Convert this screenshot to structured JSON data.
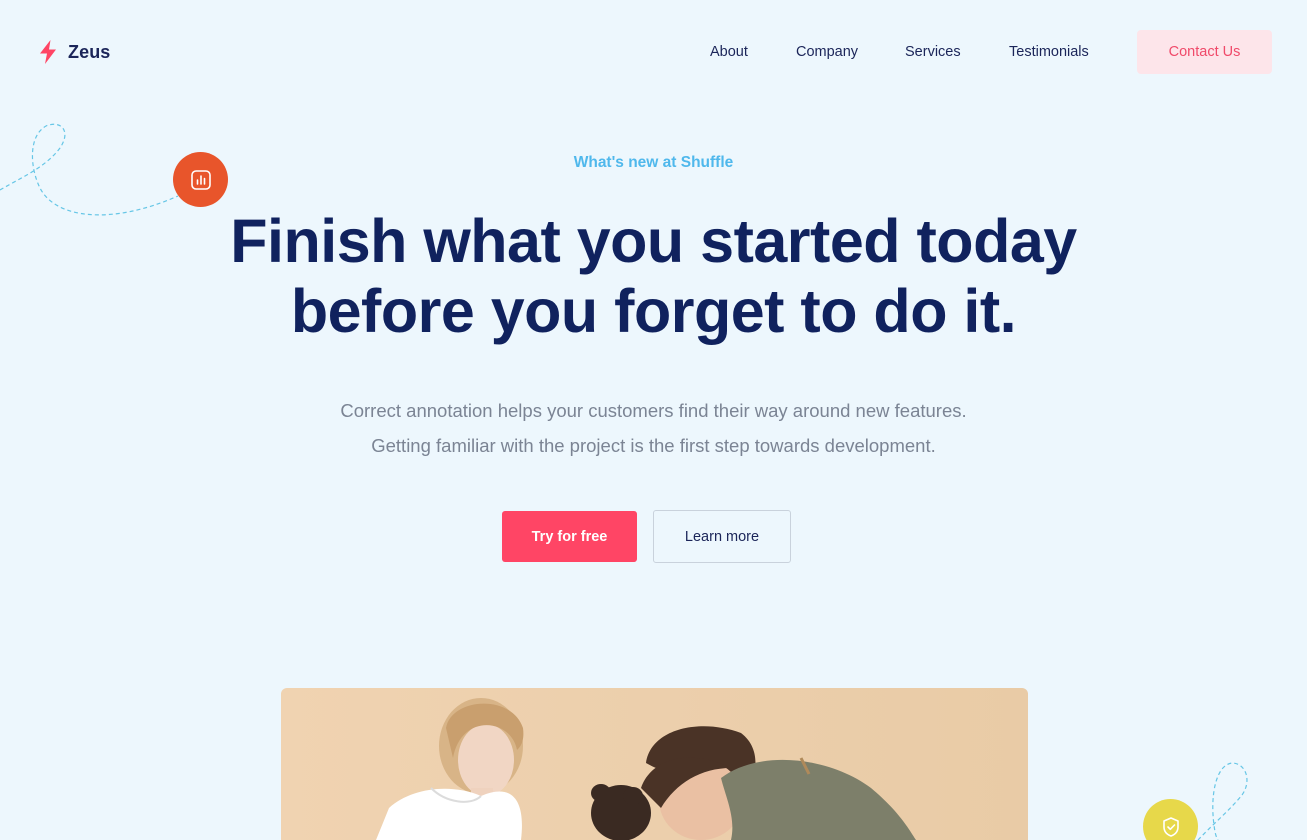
{
  "brand": {
    "name": "Zeus",
    "accent_color": "#ff4565",
    "icon": "lightning-bolt-icon"
  },
  "nav": {
    "items": [
      {
        "label": "About"
      },
      {
        "label": "Company"
      },
      {
        "label": "Services"
      },
      {
        "label": "Testimonials"
      }
    ],
    "contact_label": "Contact Us"
  },
  "hero": {
    "eyebrow": "What's new at Shuffle",
    "headline_line1": "Finish what you started today",
    "headline_line2": "before you forget to do it.",
    "subtext_line1": "Correct annotation helps your customers find their way around new features.",
    "subtext_line2": "Getting familiar with the project is the first step towards development.",
    "primary_cta": "Try for free",
    "secondary_cta": "Learn more"
  },
  "decorations": {
    "left_badge_icon": "bar-chart-icon",
    "left_badge_color": "#e8552b",
    "right_badge_icon": "shield-check-icon",
    "right_badge_color": "#e7d84a"
  },
  "colors": {
    "background": "#edf7fd",
    "heading": "#10225e",
    "eyebrow": "#4fb8ec",
    "body_text": "#7b8494"
  }
}
